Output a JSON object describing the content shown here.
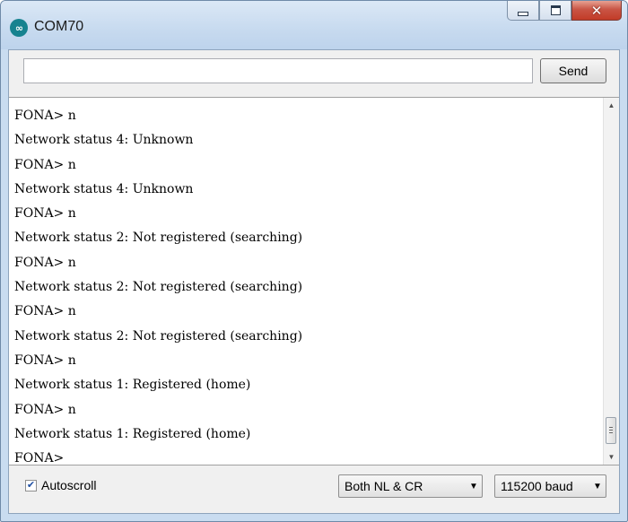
{
  "window": {
    "title": "COM70",
    "app_icon_glyph": "∞",
    "close_glyph": "✕"
  },
  "input": {
    "value": "",
    "placeholder": "",
    "send_label": "Send"
  },
  "output_lines": [
    "FONA> n",
    "Network status 4: Unknown",
    "FONA> n",
    "Network status 4: Unknown",
    "FONA> n",
    "Network status 2: Not registered (searching)",
    "FONA> n",
    "Network status 2: Not registered (searching)",
    "FONA> n",
    "Network status 2: Not registered (searching)",
    "FONA> n",
    "Network status 1: Registered (home)",
    "FONA> n",
    "Network status 1: Registered (home)",
    "FONA>"
  ],
  "footer": {
    "autoscroll_label": "Autoscroll",
    "autoscroll_checked": true,
    "check_glyph": "✔",
    "line_ending": "Both NL & CR",
    "baud": "115200 baud",
    "caret_glyph": "▼"
  },
  "scrollbar": {
    "up_glyph": "▲",
    "down_glyph": "▼"
  }
}
